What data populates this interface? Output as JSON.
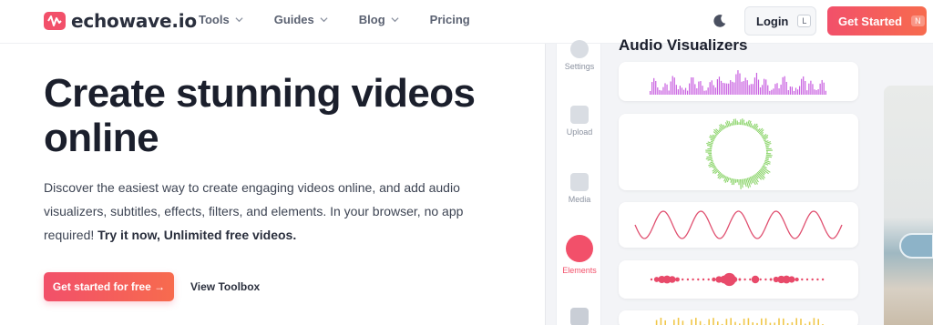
{
  "header": {
    "brand": "echowave.io",
    "nav": [
      {
        "label": "Tools",
        "has_dropdown": true
      },
      {
        "label": "Guides",
        "has_dropdown": true
      },
      {
        "label": "Blog",
        "has_dropdown": true
      },
      {
        "label": "Pricing",
        "has_dropdown": false
      }
    ],
    "theme_toggle_icon": "moon-icon",
    "login_label": "Login",
    "login_shortcut": "L",
    "get_started_label": "Get Started",
    "get_started_shortcut": "N"
  },
  "hero": {
    "title": "Create stunning videos online",
    "description": "Discover the easiest way to create engaging videos online, and add audio visualizers, subtitles, effects, filters, and elements. In your browser, no app required!",
    "description_emphasis": "Try it now, Unlimited free videos.",
    "cta_label": "Get started for free →",
    "secondary_label": "View Toolbox"
  },
  "editor_mock": {
    "panel_title": "Audio Visualizers",
    "rail": [
      {
        "label": "Settings",
        "icon": "gear-icon"
      },
      {
        "label": "Upload",
        "icon": "upload-icon"
      },
      {
        "label": "Media",
        "icon": "image-icon"
      },
      {
        "label": "Elements",
        "icon": "elements-icon",
        "active": true
      },
      {
        "label": "",
        "icon": "text-icon"
      }
    ],
    "visualizers": [
      "bars",
      "circle",
      "sine-wave",
      "dots",
      "bars-yellow"
    ]
  },
  "colors": {
    "accent": "#f2506a",
    "accent_end": "#f76b4e",
    "bars": "#c85fe0",
    "circle": "#8bd46a",
    "wave": "#e05070",
    "dots": "#e84a6a"
  }
}
